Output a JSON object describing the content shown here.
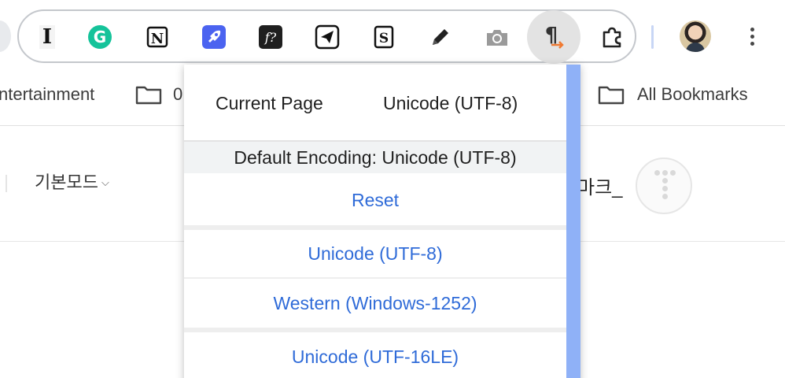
{
  "toolbar": {
    "extensions": [
      {
        "icon": "i-beam-icon",
        "glyph": "I"
      },
      {
        "icon": "grammarly-icon",
        "glyph": "G"
      },
      {
        "icon": "notion-icon",
        "glyph": "N"
      },
      {
        "icon": "rocket-icon",
        "glyph": ""
      },
      {
        "icon": "font-question-icon",
        "glyph": "f?"
      },
      {
        "icon": "paper-plane-icon",
        "glyph": ""
      },
      {
        "icon": "s-notebook-icon",
        "glyph": "S"
      },
      {
        "icon": "pencil-icon",
        "glyph": ""
      },
      {
        "icon": "camera-icon",
        "glyph": ""
      },
      {
        "icon": "pilcrow-arrow-icon",
        "glyph": "¶"
      },
      {
        "icon": "puzzle-piece-icon",
        "glyph": ""
      }
    ],
    "colors": {
      "grammarly": "#15c39a",
      "rocket_bg": "#4b63f0",
      "pilcrow_arrow": "#f07a32",
      "camera": "#9a9a9a"
    }
  },
  "bookmarks": {
    "items": [
      {
        "label": "ntertainment",
        "has_folder": false
      },
      {
        "label": "0",
        "has_folder": true
      },
      {
        "label": "All Bookmarks",
        "has_folder": true
      }
    ]
  },
  "page": {
    "mode_label": "기본모드",
    "mark_text": "마크_"
  },
  "encoding_popup": {
    "current_label": "Current Page",
    "current_value": "Unicode (UTF-8)",
    "default_text": "Default Encoding: Unicode (UTF-8)",
    "reset_label": "Reset",
    "options": [
      "Unicode (UTF-8)",
      "Western (Windows-1252)",
      "Unicode (UTF-16LE)"
    ],
    "link_color": "#2f6bd8"
  }
}
